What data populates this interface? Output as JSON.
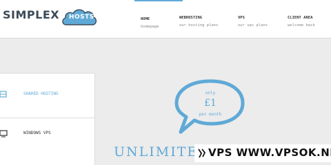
{
  "brand": {
    "name": "SIMPLEX",
    "hosts": "HOSTS"
  },
  "nav": [
    {
      "title": "HOME",
      "subtitle": "homepage"
    },
    {
      "title": "WEBHOSTING",
      "subtitle": "our hosting plans"
    },
    {
      "title": "VPS",
      "subtitle": "our vps plans"
    },
    {
      "title": "CLIENT AREA",
      "subtitle": "welcome back"
    }
  ],
  "sidebar": {
    "items": [
      {
        "label": "SHARED HOSTING"
      },
      {
        "label": "WINDOWS VPS"
      }
    ]
  },
  "promo": {
    "only": "only",
    "price": "£1",
    "per": "per month",
    "headline": "UNLIMITED S"
  },
  "watermark": {
    "text": "VPS WWW.VPSOK.NET"
  },
  "colors": {
    "accent": "#5fa9d6",
    "background": "#ececec",
    "header": "#ffffff"
  }
}
